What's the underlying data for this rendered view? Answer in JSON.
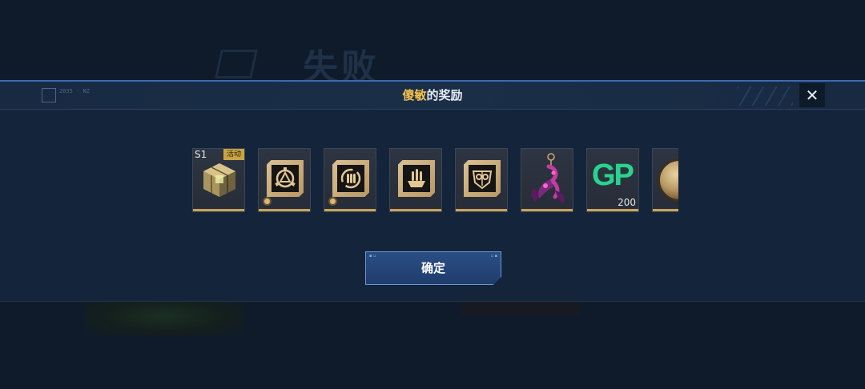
{
  "background": {
    "title": "失败"
  },
  "dialog": {
    "title_name": "傻敏",
    "title_suffix": "的奖励",
    "close_label": "✕",
    "logo_text": "2035 · NZ"
  },
  "rewards": [
    {
      "name": "cube-item",
      "badge": "活动",
      "season": "S1",
      "icon": "gold-cube-icon"
    },
    {
      "name": "emblem-triangle-item",
      "icon": "triangle-emblem-icon"
    },
    {
      "name": "ammo-cycle-item",
      "icon": "ammo-cycle-icon"
    },
    {
      "name": "ammo-rounds-item",
      "icon": "bullets-icon"
    },
    {
      "name": "mask-emblem-item",
      "icon": "mask-emblem-icon"
    },
    {
      "name": "scorpion-charm-item",
      "icon": "scorpion-charm-icon"
    },
    {
      "name": "gp-currency-item",
      "icon": "gp-icon",
      "label": "GP",
      "quantity": "200"
    },
    {
      "name": "coin-item",
      "icon": "coin-icon"
    }
  ],
  "confirm": {
    "label": "确定"
  },
  "colors": {
    "accent_gold": "#f2c14e",
    "gp_green": "#2ed190",
    "button_blue": "#1f3d6c"
  }
}
